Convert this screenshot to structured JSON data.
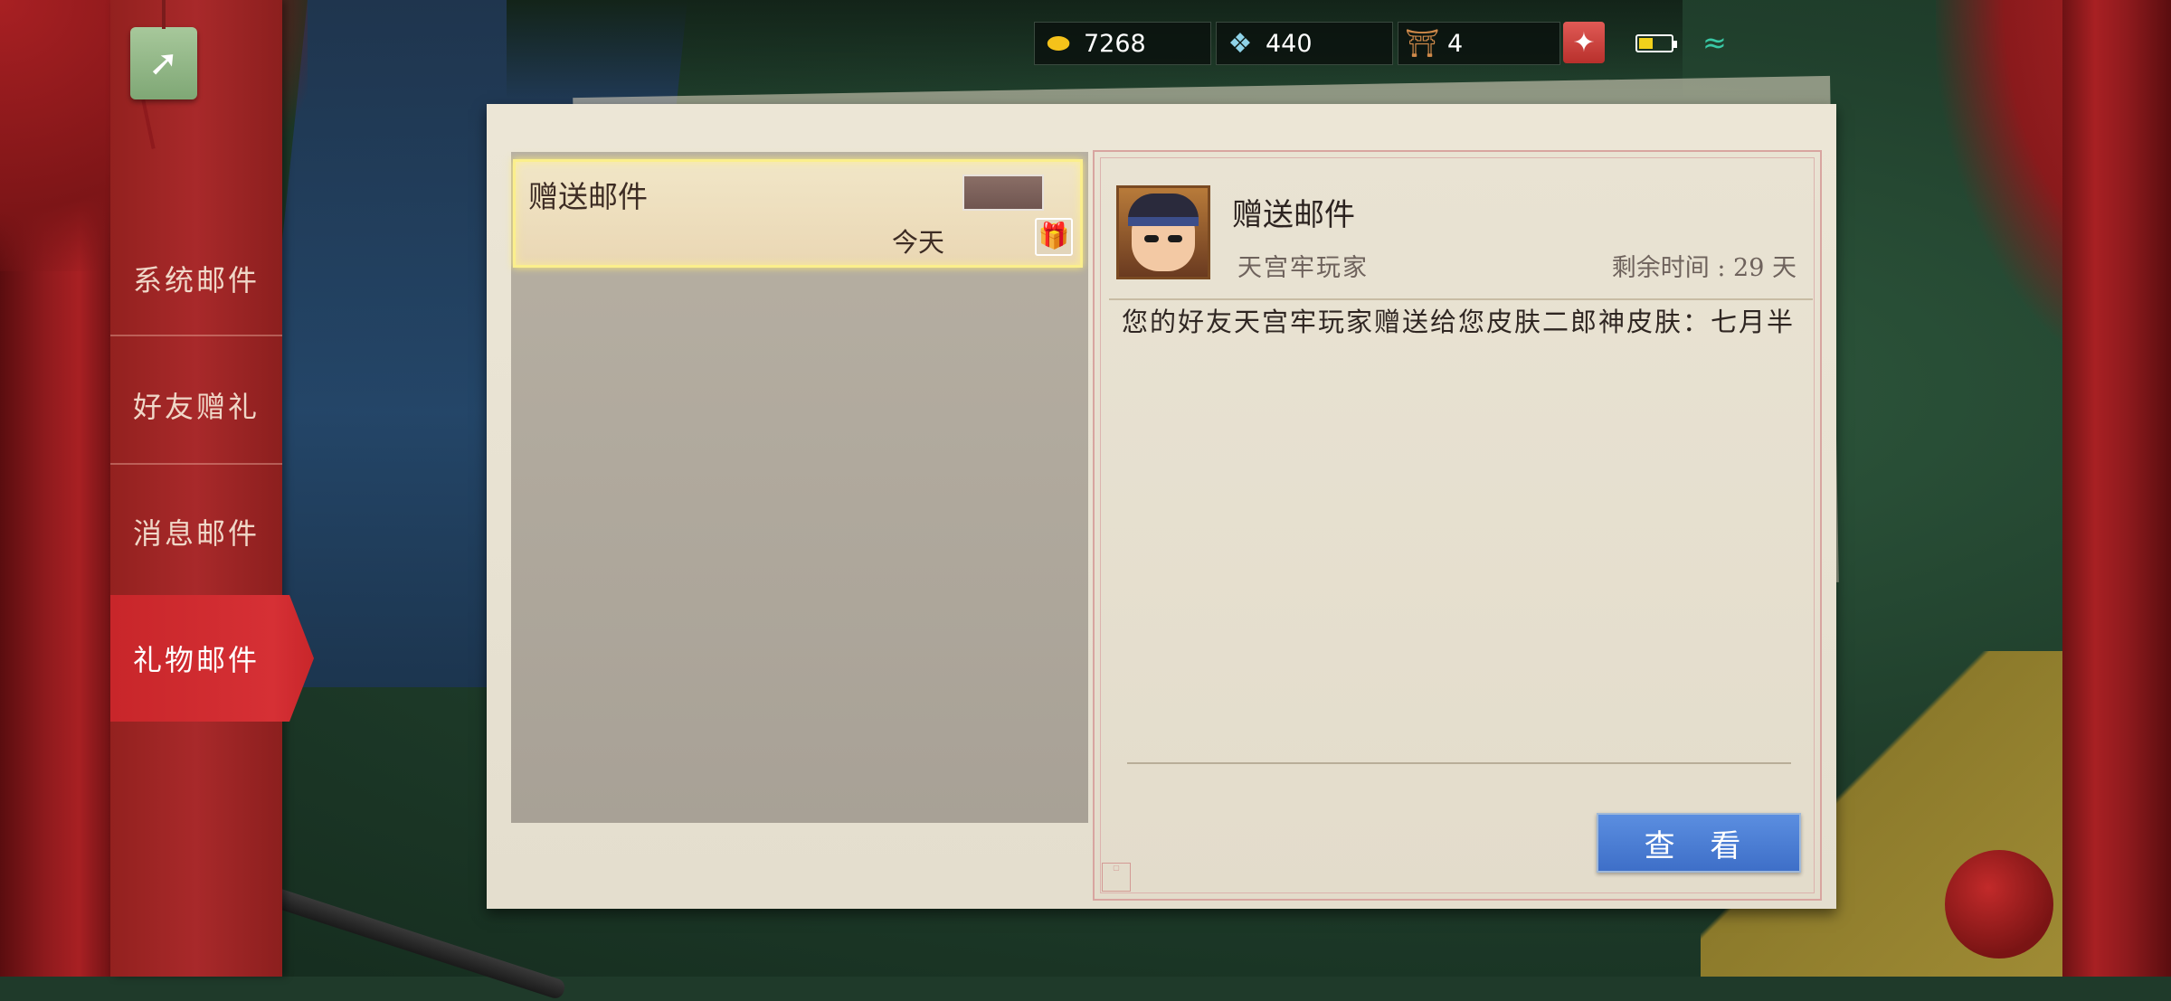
{
  "resources": {
    "gold": "7268",
    "gems": "440",
    "tickets": "4"
  },
  "status": {
    "battery_level": 0.45,
    "battery_color": "#f2d21b",
    "wifi_color": "#39c9a6"
  },
  "sidebar": {
    "items": [
      {
        "label": "系统邮件"
      },
      {
        "label": "好友赠礼"
      },
      {
        "label": "消息邮件"
      },
      {
        "label": "礼物邮件"
      }
    ],
    "active_index": 3,
    "active_color": "#d63035"
  },
  "mail_list": [
    {
      "title": "赠送邮件",
      "date": "今天"
    }
  ],
  "detail": {
    "title": "赠送邮件",
    "sender": "天宫牢玩家",
    "remaining": "剩余时间 : 29 天",
    "body": "您的好友天宫牢玩家赠送给您皮肤二郎神皮肤：七月半",
    "view_button": "查 看"
  },
  "icons": {
    "back": "back-tag-icon",
    "gold": "gold-ingot-icon",
    "gem": "gem-icon",
    "ticket": "gate-ticket-icon",
    "star": "star-badge-icon",
    "battery": "battery-icon",
    "wifi": "wifi-icon",
    "gift": "gift-icon",
    "envelope": "envelope-icon"
  }
}
